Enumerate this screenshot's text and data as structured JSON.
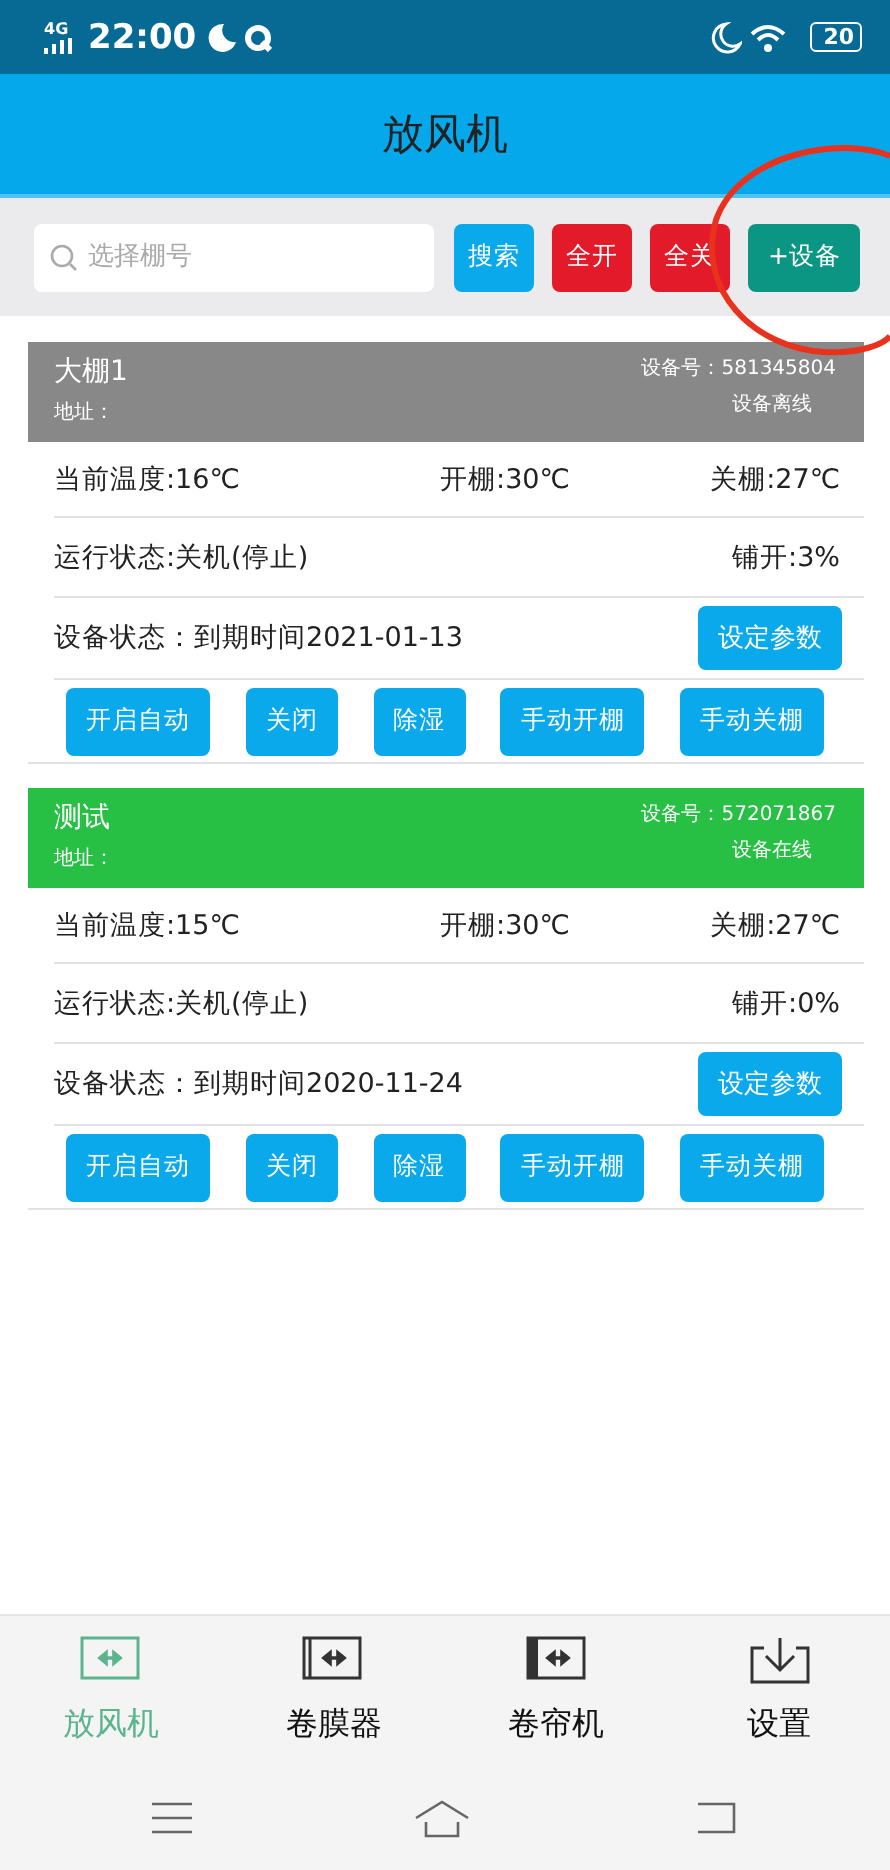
{
  "status_bar": {
    "network": "4G",
    "time": "22:00",
    "battery": "20"
  },
  "header": {
    "title": "放风机"
  },
  "search": {
    "placeholder": "选择棚号"
  },
  "toolbar_buttons": [
    {
      "label": "搜索",
      "kind": "search"
    },
    {
      "label": "全开",
      "kind": "danger"
    },
    {
      "label": "全关",
      "kind": "danger"
    },
    {
      "label": "+设备",
      "kind": "add"
    }
  ],
  "devices": [
    {
      "name": "大棚1",
      "address": "地址：",
      "device_no": "设备号：581345804",
      "online": false,
      "connection": "设备离线",
      "temperature": "当前温度:16℃",
      "open_temp": "开棚:30℃",
      "close_temp": "关棚:27℃",
      "run_state": "运行状态:关机(停止)",
      "opening": "铺开:3%",
      "device_state": "设备状态：到期时间2021-01-13",
      "settings_button": "设定参数",
      "actions": [
        "开启自动",
        "关闭",
        "除湿",
        "手动开棚",
        "手动关棚"
      ]
    },
    {
      "name": "测试",
      "address": "地址：",
      "device_no": "设备号：572071867",
      "online": true,
      "connection": "设备在线",
      "temperature": "当前温度:15℃",
      "open_temp": "开棚:30℃",
      "close_temp": "关棚:27℃",
      "run_state": "运行状态:关机(停止)",
      "opening": "铺开:0%",
      "device_state": "设备状态：到期时间2020-11-24",
      "settings_button": "设定参数",
      "actions": [
        "开启自动",
        "关闭",
        "除湿",
        "手动开棚",
        "手动关棚"
      ]
    }
  ],
  "bottom_nav": [
    {
      "label": "放风机",
      "kind": "fan",
      "selected": true
    },
    {
      "label": "卷膜器",
      "kind": "film",
      "selected": false
    },
    {
      "label": "卷帘机",
      "kind": "curtain",
      "selected": false
    },
    {
      "label": "设置",
      "kind": "settings",
      "selected": false
    }
  ]
}
